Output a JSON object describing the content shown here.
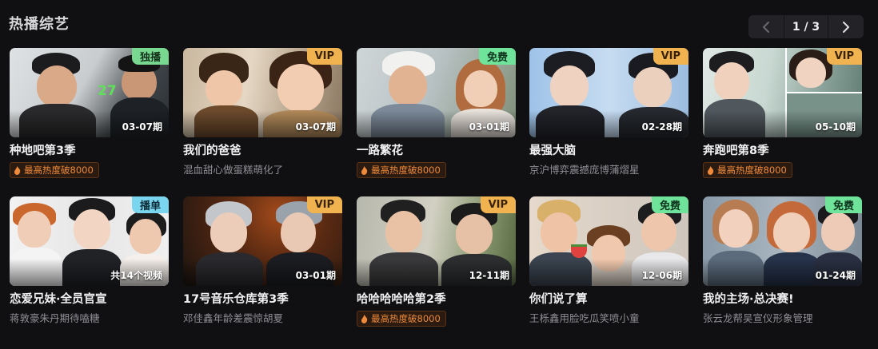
{
  "section": {
    "title": "热播综艺"
  },
  "pager": {
    "page": "1 / 3"
  },
  "cards": [
    {
      "title": "种地吧第3季",
      "badge": "独播",
      "badge_type": "excl",
      "episode": "03-07期",
      "heat": "最高热度破8000",
      "subtitle": ""
    },
    {
      "title": "我们的爸爸",
      "badge": "VIP",
      "badge_type": "vip",
      "episode": "03-07期",
      "heat": "",
      "subtitle": "混血甜心做蛋糕萌化了"
    },
    {
      "title": "一路繁花",
      "badge": "免费",
      "badge_type": "free",
      "episode": "03-01期",
      "heat": "最高热度破8000",
      "subtitle": ""
    },
    {
      "title": "最强大脑",
      "badge": "VIP",
      "badge_type": "vip",
      "episode": "02-28期",
      "heat": "",
      "subtitle": "京沪博弈震撼庞博蒲熠星"
    },
    {
      "title": "奔跑吧第8季",
      "badge": "VIP",
      "badge_type": "vip",
      "episode": "05-10期",
      "heat": "最高热度破8000",
      "subtitle": ""
    },
    {
      "title": "恋爱兄妹·全员官宣",
      "badge": "播单",
      "badge_type": "list",
      "episode": "共14个视频",
      "heat": "",
      "subtitle": "蒋敦豪朱丹期待嗑糖"
    },
    {
      "title": "17号音乐仓库第3季",
      "badge": "VIP",
      "badge_type": "vip",
      "episode": "03-01期",
      "heat": "",
      "subtitle": "邓佳鑫年龄差震惊胡夏"
    },
    {
      "title": "哈哈哈哈哈第2季",
      "badge": "VIP",
      "badge_type": "vip",
      "episode": "12-11期",
      "heat": "最高热度破8000",
      "subtitle": ""
    },
    {
      "title": "你们说了算",
      "badge": "免费",
      "badge_type": "free",
      "episode": "12-06期",
      "heat": "",
      "subtitle": "王栎鑫用脸吃瓜笑喷小童"
    },
    {
      "title": "我的主场·总决赛!",
      "badge": "免费",
      "badge_type": "free",
      "episode": "01-24期",
      "heat": "",
      "subtitle": "张云龙帮吴宣仪形象管理"
    }
  ],
  "icons": {
    "prev": "chevron-left-icon",
    "next": "chevron-right-icon",
    "heat": "flame-icon"
  },
  "colors": {
    "background": "#101012",
    "vip": "#f0b350",
    "free": "#6fe39a",
    "heat": "#ee8a3a"
  }
}
